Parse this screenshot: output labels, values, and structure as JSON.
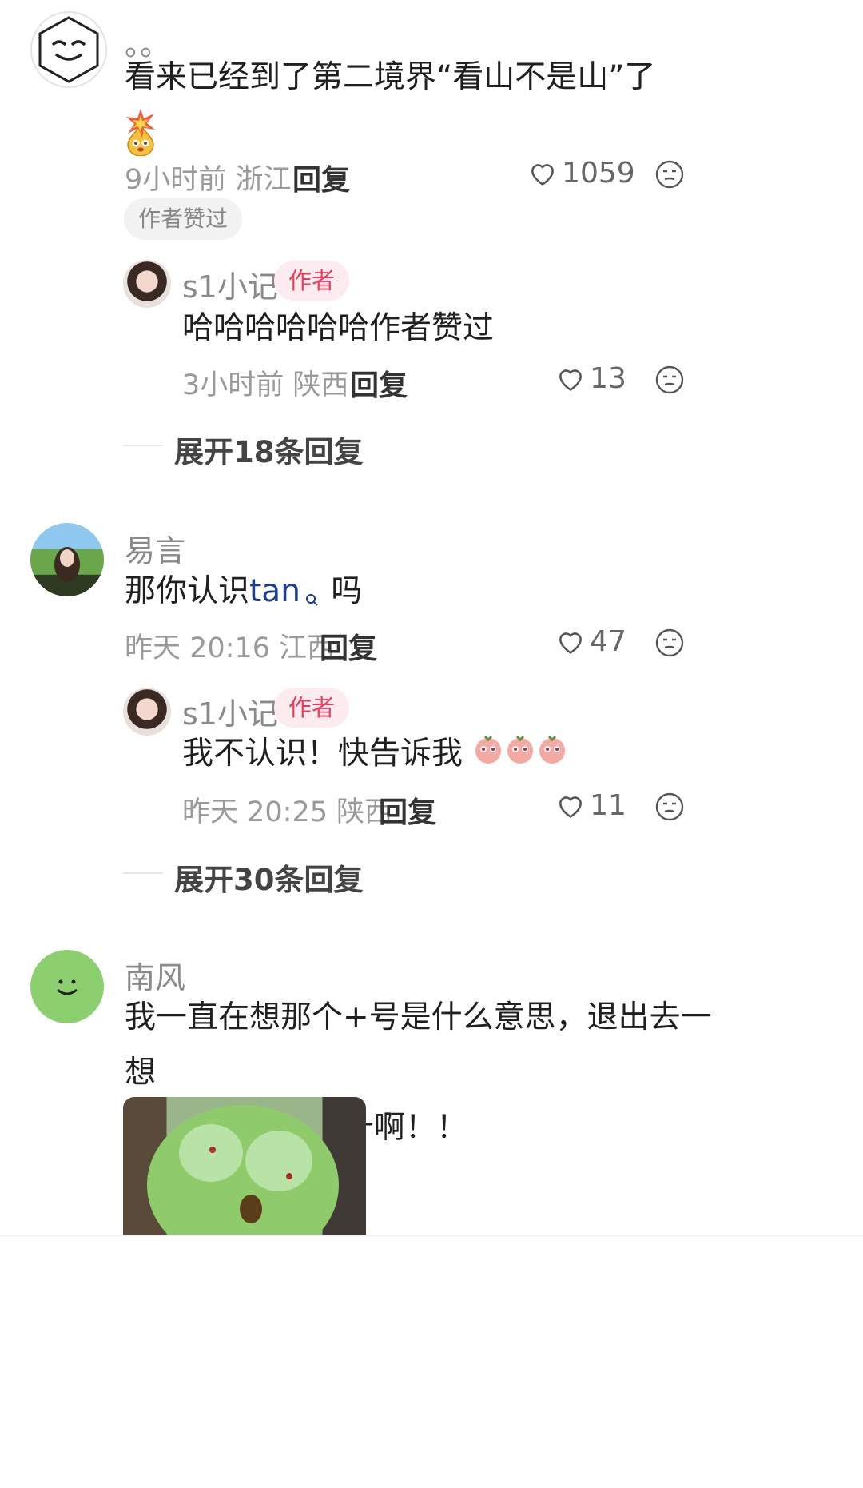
{
  "comments": [
    {
      "name": "。。",
      "text": "看来已经到了第二境界“看山不是山”了",
      "time": "9小时前",
      "location": "浙江",
      "reply_label": "回复",
      "likes": "1059",
      "tag": "作者赞过",
      "reply": {
        "name": "s1小记",
        "badge": "作者",
        "text": "哈哈哈哈哈哈作者赞过",
        "time": "3小时前",
        "location": "陕西",
        "reply_label": "回复",
        "likes": "13"
      },
      "expand": "展开18条回复"
    },
    {
      "name": "易言",
      "text_before": "那你认识",
      "link": "tan",
      "text_after": " 吗",
      "time": "昨天 20:16",
      "location": "江西",
      "reply_label": "回复",
      "likes": "47",
      "reply": {
        "name": "s1小记",
        "badge": "作者",
        "text": "我不认识！快告诉我",
        "time": "昨天 20:25",
        "location": "陕西",
        "reply_label": "回复",
        "likes": "11"
      },
      "expand": "展开30条回复"
    },
    {
      "name": "南风",
      "text_line1": "我一直在想那个+号是什么意思，退出去一想",
      "text_line2": "呢是十啊，数字十啊！！"
    }
  ],
  "icons": [
    "heart-outline-icon",
    "sad-face-icon",
    "fire-emoji-icon",
    "sweat-emoji-icon",
    "search-icon"
  ],
  "colors": {
    "author_badge_bg": "#fdecef",
    "author_badge_text": "#f03a5b",
    "link": "#1c3f8f",
    "avatar_green": "#8ccf6f"
  }
}
